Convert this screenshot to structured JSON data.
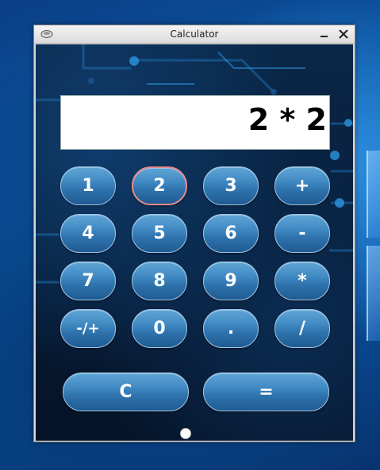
{
  "window": {
    "title": "Calculator",
    "app_icon": "calculator-app-icon",
    "minimize_icon": "minimize-icon",
    "close_icon": "close-icon"
  },
  "display": {
    "value": "2 * 2"
  },
  "keys": {
    "row1": [
      "1",
      "2",
      "3",
      "+"
    ],
    "row2": [
      "4",
      "5",
      "6",
      "-"
    ],
    "row3": [
      "7",
      "8",
      "9",
      "*"
    ],
    "row4": [
      "-/+",
      "0",
      ".",
      "/"
    ],
    "clear": "C",
    "equals": "="
  },
  "focused_key": "2",
  "colors": {
    "button_top": "#5fa6d6",
    "button_bottom": "#1f5b92",
    "focus_border": "#e38b8b",
    "display_bg": "#ffffff",
    "background": "#071a33"
  }
}
